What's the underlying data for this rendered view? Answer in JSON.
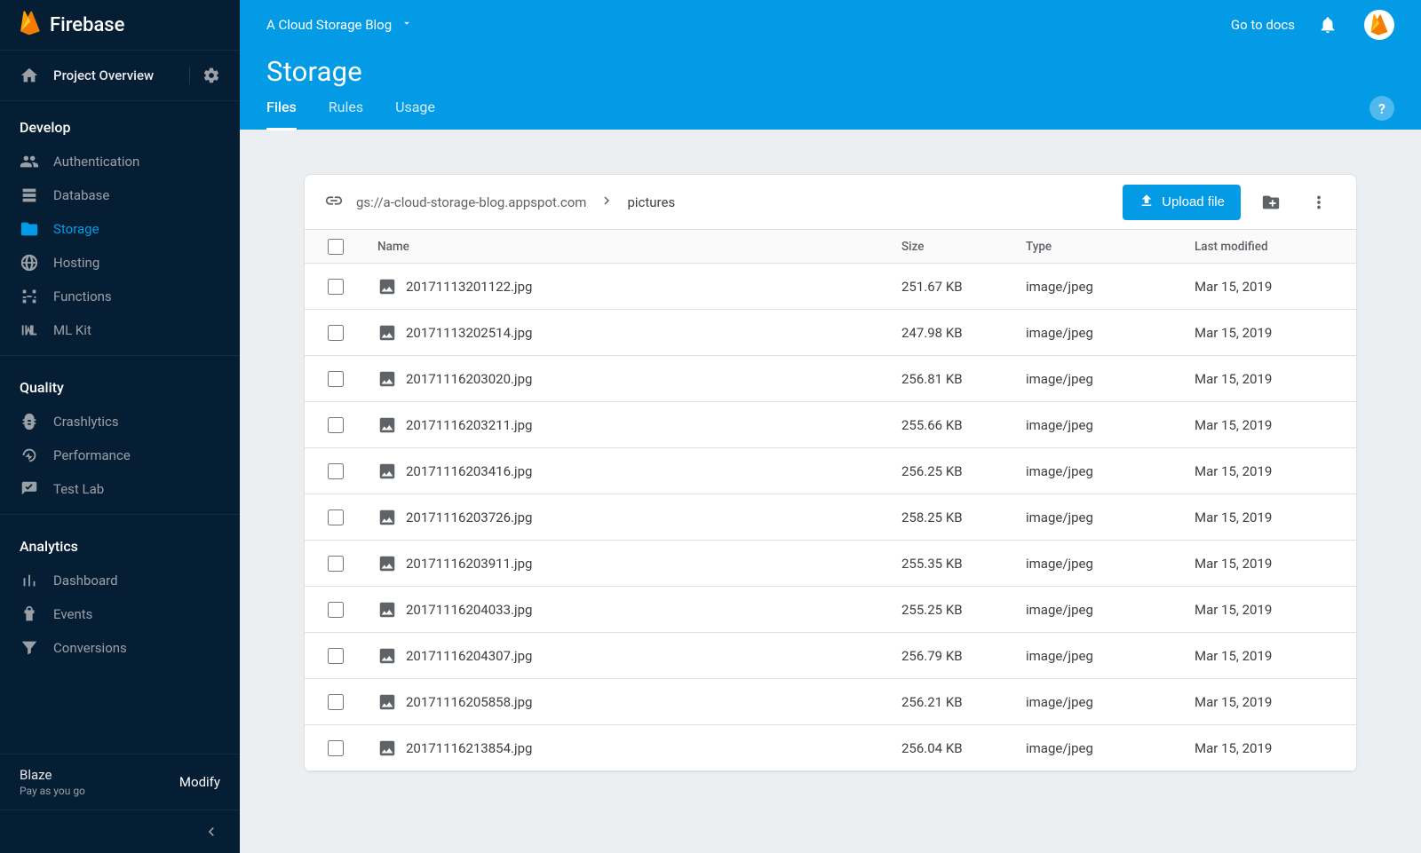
{
  "brand": "Firebase",
  "overview_label": "Project Overview",
  "sidebar": {
    "sections": [
      {
        "title": "Develop",
        "items": [
          {
            "label": "Authentication",
            "icon": "people"
          },
          {
            "label": "Database",
            "icon": "database"
          },
          {
            "label": "Storage",
            "icon": "folder",
            "active": true
          },
          {
            "label": "Hosting",
            "icon": "globe"
          },
          {
            "label": "Functions",
            "icon": "functions"
          },
          {
            "label": "ML Kit",
            "icon": "ml"
          }
        ]
      },
      {
        "title": "Quality",
        "items": [
          {
            "label": "Crashlytics",
            "icon": "crash"
          },
          {
            "label": "Performance",
            "icon": "perf"
          },
          {
            "label": "Test Lab",
            "icon": "testlab"
          }
        ]
      },
      {
        "title": "Analytics",
        "items": [
          {
            "label": "Dashboard",
            "icon": "dashboard"
          },
          {
            "label": "Events",
            "icon": "events"
          },
          {
            "label": "Conversions",
            "icon": "conversions"
          }
        ]
      }
    ],
    "plan": {
      "name": "Blaze",
      "sub": "Pay as you go",
      "modify": "Modify"
    }
  },
  "header": {
    "project": "A Cloud Storage Blog",
    "docs": "Go to docs",
    "page_title": "Storage",
    "tabs": [
      "Files",
      "Rules",
      "Usage"
    ],
    "active_tab": 0
  },
  "storage": {
    "link_prefix": "gs://a-cloud-storage-blog.appspot.com",
    "crumb": "pictures",
    "upload_label": "Upload file",
    "columns": {
      "name": "Name",
      "size": "Size",
      "type": "Type",
      "modified": "Last modified"
    },
    "files": [
      {
        "name": "20171113201122.jpg",
        "size": "251.67 KB",
        "type": "image/jpeg",
        "modified": "Mar 15, 2019"
      },
      {
        "name": "20171113202514.jpg",
        "size": "247.98 KB",
        "type": "image/jpeg",
        "modified": "Mar 15, 2019"
      },
      {
        "name": "20171116203020.jpg",
        "size": "256.81 KB",
        "type": "image/jpeg",
        "modified": "Mar 15, 2019"
      },
      {
        "name": "20171116203211.jpg",
        "size": "255.66 KB",
        "type": "image/jpeg",
        "modified": "Mar 15, 2019"
      },
      {
        "name": "20171116203416.jpg",
        "size": "256.25 KB",
        "type": "image/jpeg",
        "modified": "Mar 15, 2019"
      },
      {
        "name": "20171116203726.jpg",
        "size": "258.25 KB",
        "type": "image/jpeg",
        "modified": "Mar 15, 2019"
      },
      {
        "name": "20171116203911.jpg",
        "size": "255.35 KB",
        "type": "image/jpeg",
        "modified": "Mar 15, 2019"
      },
      {
        "name": "20171116204033.jpg",
        "size": "255.25 KB",
        "type": "image/jpeg",
        "modified": "Mar 15, 2019"
      },
      {
        "name": "20171116204307.jpg",
        "size": "256.79 KB",
        "type": "image/jpeg",
        "modified": "Mar 15, 2019"
      },
      {
        "name": "20171116205858.jpg",
        "size": "256.21 KB",
        "type": "image/jpeg",
        "modified": "Mar 15, 2019"
      },
      {
        "name": "20171116213854.jpg",
        "size": "256.04 KB",
        "type": "image/jpeg",
        "modified": "Mar 15, 2019"
      }
    ]
  }
}
